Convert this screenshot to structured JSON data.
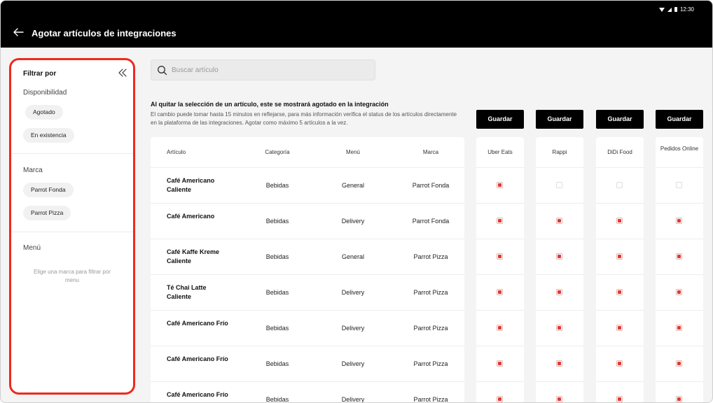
{
  "status": {
    "time": "12:30"
  },
  "app": {
    "title": "Agotar artículos de integraciones"
  },
  "sidebar": {
    "title": "Filtrar por",
    "availability_label": "Disponibilidad",
    "availability_options": [
      "Agotado",
      "En existencia"
    ],
    "brand_label": "Marca",
    "brand_options": [
      "Parrot Fonda",
      "Parrot Pizza"
    ],
    "menu_label": "Menú",
    "menu_hint": "Elige una marca para filtrar por menu"
  },
  "search": {
    "placeholder": "Buscar artículo",
    "value": ""
  },
  "info": {
    "title": "Al quitar la selección de un artículo, este se mostrará agotado en la integración",
    "subtitle": "El cambio puede tomar hasta 15 minutos en reflejarse, para más información verifica el status de los artículos directamente en la plataforma de las integraciones. Agotar como máximo 5 artículos a la vez."
  },
  "columns": [
    "Artículo",
    "Categoría",
    "Menú",
    "Marca"
  ],
  "integrations": [
    {
      "name": "Uber Eats",
      "save_label": "Guardar"
    },
    {
      "name": "Rappi",
      "save_label": "Guardar"
    },
    {
      "name": "DiDi Food",
      "save_label": "Guardar"
    },
    {
      "name": "Pedidos Online",
      "save_label": "Guardar"
    }
  ],
  "rows": [
    {
      "article": "Café Americano Caliente",
      "category": "Bebidas",
      "menu": "General",
      "brand": "Parrot Fonda",
      "checks": [
        true,
        false,
        false,
        false
      ]
    },
    {
      "article": "Café Americano",
      "category": "Bebidas",
      "menu": "Delivery",
      "brand": "Parrot Fonda",
      "checks": [
        true,
        true,
        true,
        true
      ]
    },
    {
      "article": "Café Kaffe Kreme Caliente",
      "category": "Bebidas",
      "menu": "General",
      "brand": "Parrot Pizza",
      "checks": [
        true,
        true,
        true,
        true
      ]
    },
    {
      "article": "Té Chai Latte Caliente",
      "category": "Bebidas",
      "menu": "Delivery",
      "brand": "Parrot Pizza",
      "checks": [
        true,
        true,
        true,
        true
      ]
    },
    {
      "article": "Café Americano Frío",
      "category": "Bebidas",
      "menu": "Delivery",
      "brand": "Parrot Pizza",
      "checks": [
        true,
        true,
        true,
        true
      ]
    },
    {
      "article": "Café Americano Frío",
      "category": "Bebidas",
      "menu": "Delivery",
      "brand": "Parrot Pizza",
      "checks": [
        true,
        true,
        true,
        true
      ]
    },
    {
      "article": "Café Americano Frío",
      "category": "Bebidas",
      "menu": "Delivery",
      "brand": "Parrot Pizza",
      "checks": [
        true,
        true,
        true,
        true
      ]
    }
  ]
}
